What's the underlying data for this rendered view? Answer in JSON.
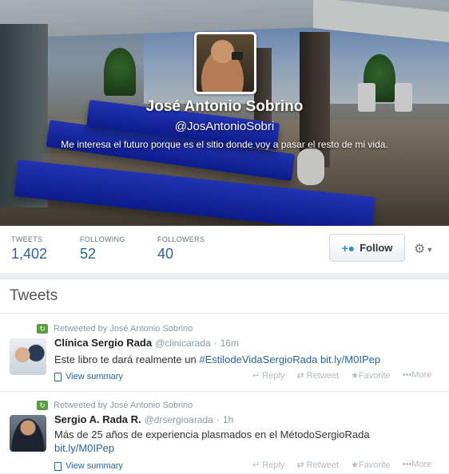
{
  "profile": {
    "name": "José Antonio Sobrino",
    "handle": "@JosAntonioSobri",
    "bio": "Me interesa el futuro porque es el sitio donde voy a pasar el resto de mi vida."
  },
  "stats": [
    {
      "label": "TWEETS",
      "value": "1,402"
    },
    {
      "label": "FOLLOWING",
      "value": "52"
    },
    {
      "label": "FOLLOWERS",
      "value": "40"
    }
  ],
  "follow_label": "Follow",
  "tweets_title": "Tweets",
  "tweets": [
    {
      "retweeted_by": "Retweeted by José Antonio Sobrino",
      "author": "Clínica Sergio Rada",
      "handle": "@clinicarada",
      "time": "16m",
      "text": "Este libro te dará realmente un ",
      "hashtag": "#EstilodeVidaSergioRada",
      "link": "bit.ly/M0IPep",
      "summary": "View summary"
    },
    {
      "retweeted_by": "Retweeted by José Antonio Sobrino",
      "author": "Sergio A. Rada R.",
      "handle": "@drsergioarada",
      "time": "1h",
      "text": "Más de 25 años de experiencia plasmados en el MétodoSergioRada",
      "link": "bit.ly/M0IPep",
      "summary": "View summary"
    }
  ],
  "actions": {
    "reply": "Reply",
    "retweet": "Retweet",
    "favorite": "Favorite",
    "more": "More"
  },
  "icons": [
    "add-user-icon",
    "gear-icon",
    "retweet-icon",
    "reply-icon",
    "star-icon",
    "more-icon",
    "document-icon"
  ],
  "colors": {
    "link": "#2a6496",
    "retweet_badge": "#5c9d44",
    "lounger": "#1a2fc4"
  }
}
